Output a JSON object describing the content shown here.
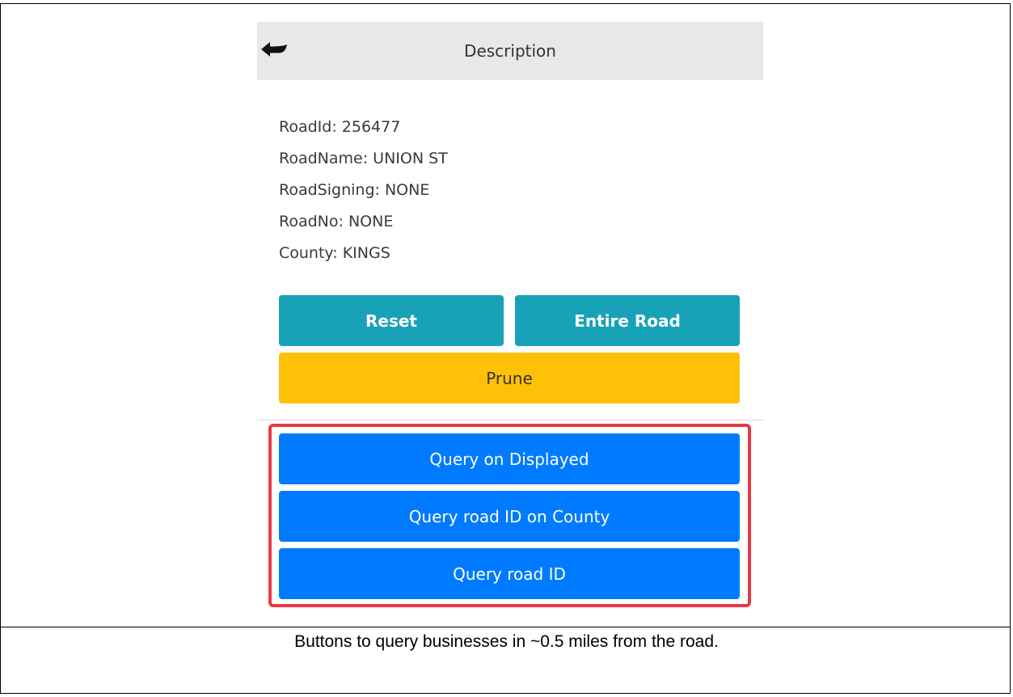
{
  "panel": {
    "title": "Description",
    "back_icon": "back-arrow-icon"
  },
  "info": {
    "road_id": "RoadId: 256477",
    "road_name": "RoadName: UNION ST",
    "road_signing": "RoadSigning: NONE",
    "road_no": "RoadNo: NONE",
    "county": "County: KINGS"
  },
  "buttons": {
    "reset": "Reset",
    "entire_road": "Entire Road",
    "prune": "Prune",
    "query_displayed": "Query on Displayed",
    "query_road_id_county": "Query road ID on County",
    "query_road_id": "Query road ID"
  },
  "caption": "Buttons to query businesses in ~0.5 miles from the road.",
  "colors": {
    "info_button": "#17a2b8",
    "warning_button": "#ffc107",
    "primary_button": "#007bff",
    "highlight_border": "#e63946",
    "header_bg": "#e8e8e8"
  }
}
